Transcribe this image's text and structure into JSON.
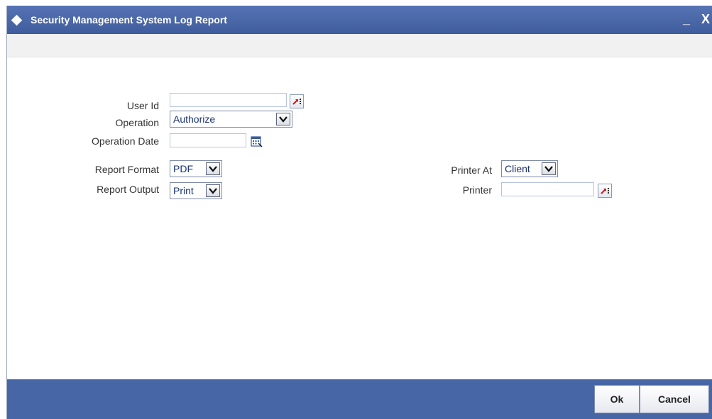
{
  "window": {
    "title": "Security Management System Log Report",
    "minimize_label": "_",
    "close_label": "X"
  },
  "form": {
    "user_id": {
      "label": "User Id",
      "value": ""
    },
    "operation": {
      "label": "Operation",
      "value": "Authorize"
    },
    "operation_date": {
      "label": "Operation Date",
      "value": ""
    },
    "report_format": {
      "label": "Report Format",
      "value": "PDF"
    },
    "report_output": {
      "label": "Report Output",
      "value": "Print"
    },
    "printer_at": {
      "label": "Printer At",
      "value": "Client"
    },
    "printer": {
      "label": "Printer",
      "value": ""
    }
  },
  "footer": {
    "ok_label": "Ok",
    "cancel_label": "Cancel"
  },
  "colors": {
    "titlebar": "#4766a5",
    "footer": "#4766a5",
    "select_text": "#1a3370",
    "lov_arrow": "#d01818"
  },
  "icons": {
    "title": "diamond-icon",
    "lov": "lov-arrow-icon",
    "calendar": "calendar-icon",
    "dropdown": "chevron-down-icon"
  }
}
